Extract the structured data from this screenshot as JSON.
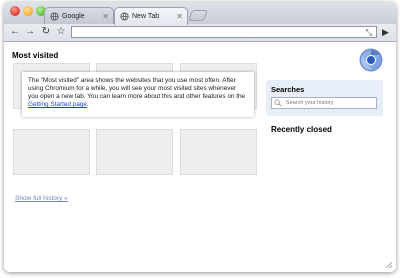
{
  "tabs": [
    {
      "label": "Google",
      "icon": "globe-icon",
      "active": false
    },
    {
      "label": "New Tab",
      "icon": "globe-icon",
      "active": true
    }
  ],
  "toolbar": {
    "back_icon": "back-arrow-icon",
    "forward_icon": "forward-arrow-icon",
    "reload_icon": "reload-icon",
    "star_icon": "star-icon",
    "omnibox_value": "",
    "go_icon": "go-arrow-icon"
  },
  "most_visited": {
    "title": "Most visited",
    "info_text": "The \"Most visited\" area shows the websites that you use most often. After using Chromium for a while, you will see your most visited sites whenever you open a new tab. You can learn more about this and other features on the ",
    "info_link": "Getting Started page",
    "info_end": ".",
    "thumbnail_count": 6
  },
  "history_link": "Show full history »",
  "searches": {
    "title": "Searches",
    "placeholder": "Search your history"
  },
  "recently_closed": {
    "title": "Recently closed"
  },
  "colors": {
    "link": "#1a45d6",
    "searches_bg": "#e8eef9",
    "thumb_bg": "#eeeeee"
  }
}
